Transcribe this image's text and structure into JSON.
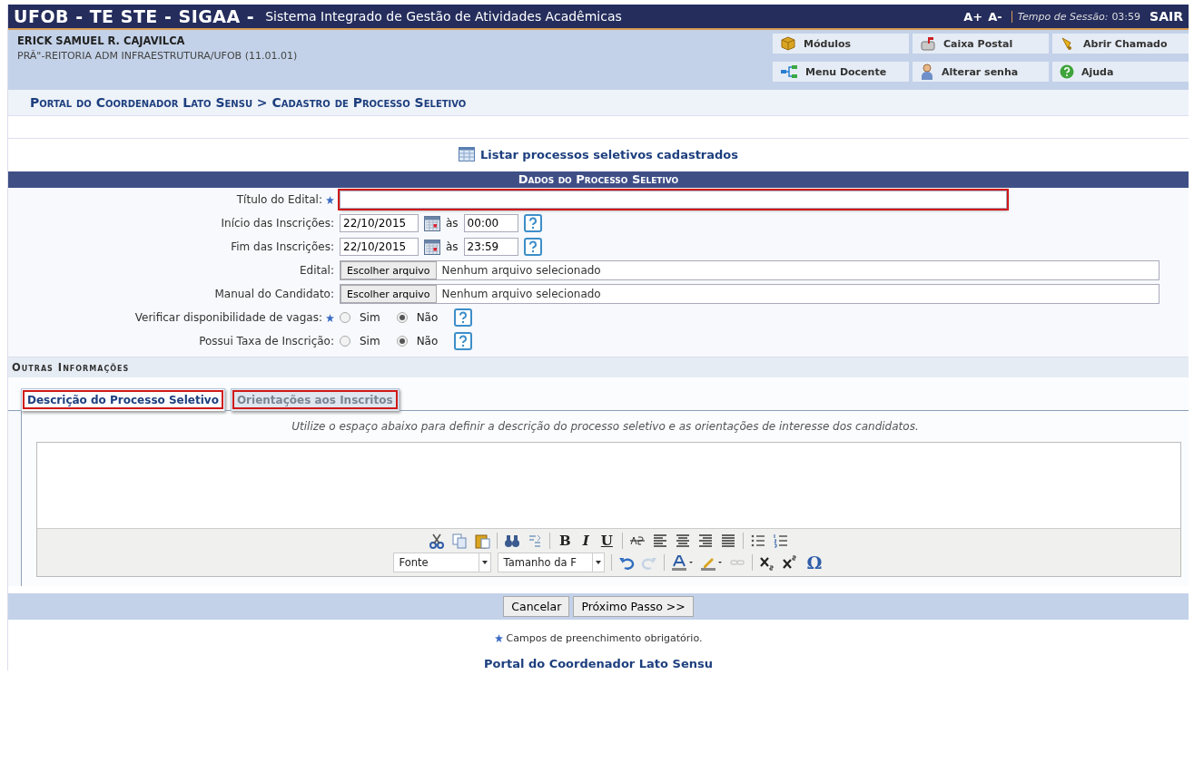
{
  "top_bar": {
    "system": "UFOB - TE STE - SIGAA -",
    "title": "Sistema Integrado de Gestão de Atividades Acadêmicas",
    "font_plus": "A+",
    "font_minus": "A-",
    "session_label": "Tempo de Sessão:",
    "session_time": "03:59",
    "logout": "SAIR"
  },
  "user": {
    "name": "ERICK SAMUEL R. CAJAVILCA",
    "unit": "PRÃ\"-REITORIA ADM INFRAESTRUTURA/UFOB (11.01.01)"
  },
  "shortcuts": [
    {
      "label": "Módulos",
      "kind": "modules"
    },
    {
      "label": "Caixa Postal",
      "kind": "mail"
    },
    {
      "label": "Abrir Chamado",
      "kind": "bell"
    },
    {
      "label": "Menu Docente",
      "kind": "tree"
    },
    {
      "label": "Alterar senha",
      "kind": "person"
    },
    {
      "label": "Ajuda",
      "kind": "help"
    }
  ],
  "breadcrumb": "Portal do Coordenador Lato Sensu > Cadastro de Processo Seletivo",
  "list_link": "Listar processos seletivos cadastrados",
  "form": {
    "title": "Dados do Processo Seletivo",
    "rows": [
      {
        "kind": "text",
        "label": "Título do Edital:",
        "required": true,
        "highlighted": true
      },
      {
        "kind": "datetime",
        "label": "Início das Inscrições:",
        "date": "22/10/2015",
        "at": "às",
        "time": "00:00",
        "help": true
      },
      {
        "kind": "datetime",
        "label": "Fim das Inscrições:",
        "date": "22/10/2015",
        "at": "às",
        "time": "23:59",
        "help": true
      },
      {
        "kind": "file",
        "label": "Edital:",
        "button": "Escolher arquivo",
        "status": "Nenhum arquivo selecionado"
      },
      {
        "kind": "file",
        "label": "Manual do Candidato:",
        "button": "Escolher arquivo",
        "status": "Nenhum arquivo selecionado"
      },
      {
        "kind": "radio",
        "label": "Verificar disponibilidade de vagas:",
        "required": true,
        "options": [
          {
            "label": "Sim",
            "selected": false
          },
          {
            "label": "Não",
            "selected": true
          }
        ],
        "help": true
      },
      {
        "kind": "radio",
        "label": "Possui Taxa de Inscrição:",
        "options": [
          {
            "label": "Sim",
            "selected": false
          },
          {
            "label": "Não",
            "selected": true
          }
        ],
        "help": true
      }
    ],
    "section": "Outras Informações",
    "tabs": [
      {
        "label": "Descrição do Processo Seletivo",
        "selected": true,
        "highlighted": true
      },
      {
        "label": "Orientações aos Inscritos",
        "selected": false,
        "highlighted": true
      }
    ],
    "hint": "Utilize o espaço abaixo para definir a descrição do processo seletivo e as orientações de interesse dos candidatos.",
    "editor": {
      "bold": "B",
      "italic": "I",
      "underline": "U",
      "font": "Fonte",
      "size": "Tamanho da F",
      "special": "Ω"
    },
    "buttons": [
      "Cancelar",
      "Próximo Passo >>"
    ]
  },
  "required_note": "Campos de preenchimento obrigatório.",
  "footer_link": "Portal do Coordenador Lato Sensu"
}
